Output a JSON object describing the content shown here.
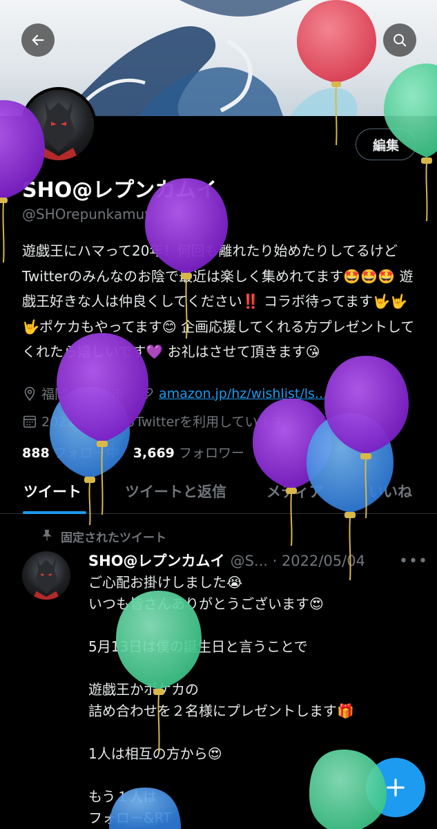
{
  "header": {
    "back_icon": "arrow-left-icon",
    "search_icon": "search-icon"
  },
  "profile": {
    "edit_label": "編集",
    "name": "SHO@レプンカムイ",
    "handle": "@SHOrepunkamuy",
    "bio": "遊戯王にハマって20年！何回も離れたり始めたりしてるけどTwitterのみんなのお陰で最近は楽しく集めれてます🤩🤩🤩 遊戯王好きな人は仲良くしてください‼️ コラボ待ってます🤟🤟🤟ポケカもやってます😊 企画応援してくれる方プレゼントしてくれたら嬉しいです💜 お礼はさせて頂きます😘",
    "location": "福岡 北九州市",
    "link": "amazon.jp/hz/wishlist/ls...",
    "joined": "2021年6月からTwitterを利用しています",
    "following_count": "888",
    "following_label": "フォロー中",
    "followers_count": "3,669",
    "followers_label": "フォロワー"
  },
  "tabs": [
    {
      "label": "ツイート"
    },
    {
      "label": "ツイートと返信"
    },
    {
      "label": "メディア"
    },
    {
      "label": "いいね"
    }
  ],
  "tweet": {
    "pinned_label": "固定されたツイート",
    "name": "SHO@レプンカムイ",
    "meta": "@S... · 2022/05/04",
    "body": "ご心配お掛けしました😭\nいつも皆さんありがとうございます😍\n\n5月13日は僕の誕生日と言うことで\n\n遊戯王かポケカの\n詰め合わせを２名様にプレゼントします🎁\n\n1人は相互の方から😍\n\nもう１人は\nフォロー&RT"
  },
  "fab": {
    "icon": "plus-icon"
  },
  "colors": {
    "accent": "#1d9bf0",
    "background": "#000000",
    "muted": "#71767b",
    "balloon_purple": "#8e2fd6",
    "balloon_blue": "#3d8ee6",
    "balloon_green": "#52d39a",
    "balloon_red": "#e4505f"
  }
}
